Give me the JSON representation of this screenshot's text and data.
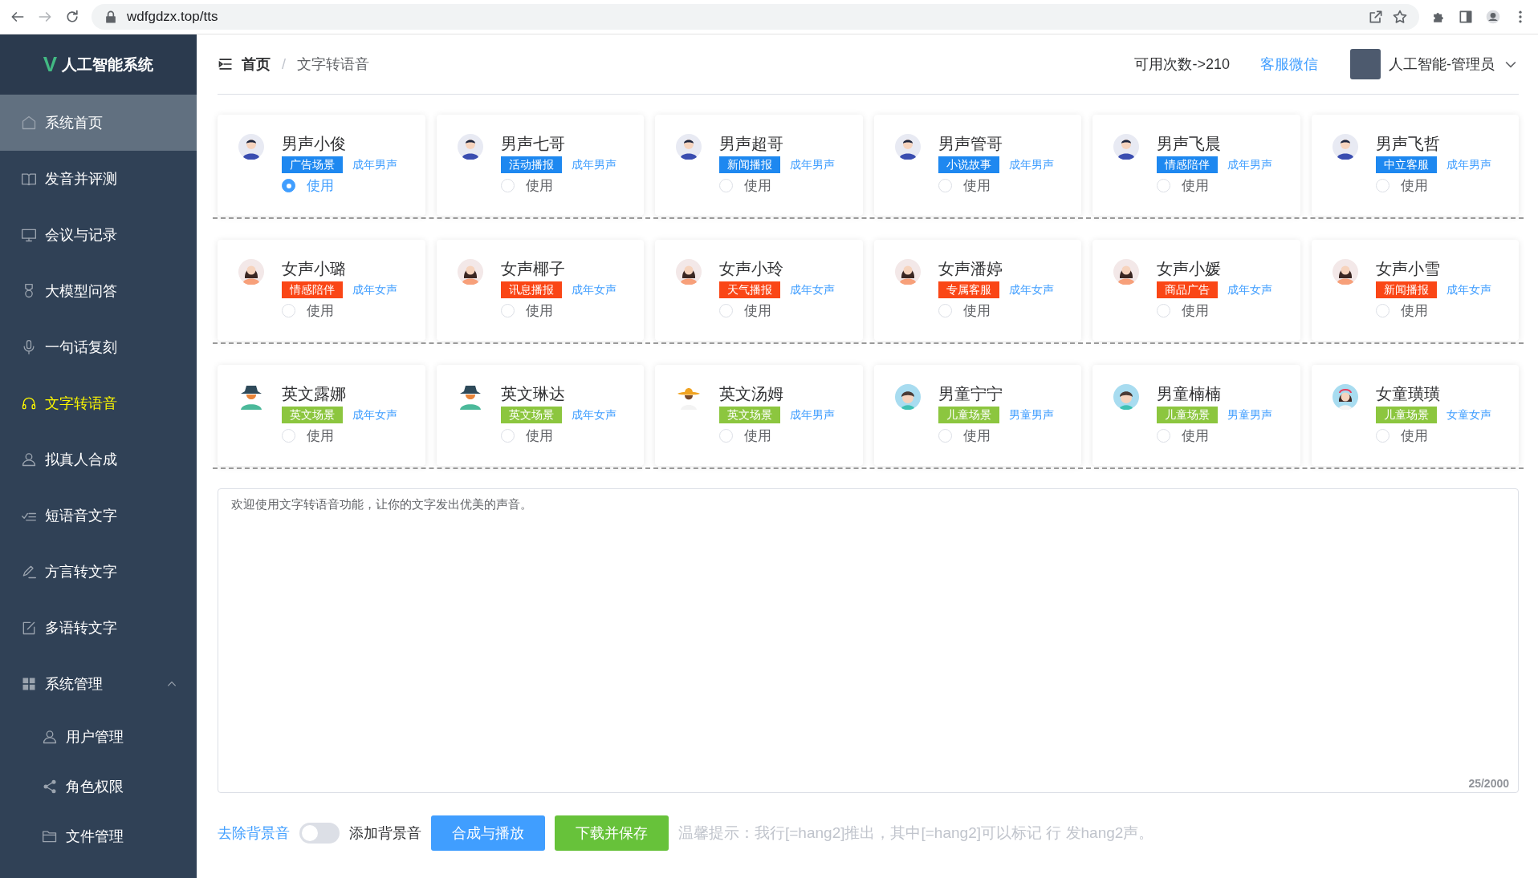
{
  "browser": {
    "url": "wdfgdzx.top/tts"
  },
  "sidebar": {
    "logo": "V",
    "title": "人工智能系统",
    "items": [
      {
        "label": "系统首页",
        "kind": "home",
        "selected": false,
        "hovered": true
      },
      {
        "label": "发音并评测",
        "kind": "book",
        "selected": false,
        "hovered": false
      },
      {
        "label": "会议与记录",
        "kind": "monitor",
        "selected": false,
        "hovered": false
      },
      {
        "label": "大模型问答",
        "kind": "medal",
        "selected": false,
        "hovered": false
      },
      {
        "label": "一句话复刻",
        "kind": "mic",
        "selected": false,
        "hovered": false
      },
      {
        "label": "文字转语音",
        "kind": "headset",
        "selected": true,
        "hovered": false
      },
      {
        "label": "拟真人合成",
        "kind": "user",
        "selected": false,
        "hovered": false
      },
      {
        "label": "短语音文字",
        "kind": "list",
        "selected": false,
        "hovered": false
      },
      {
        "label": "方言转文字",
        "kind": "pen",
        "selected": false,
        "hovered": false
      },
      {
        "label": "多语转文字",
        "kind": "edit",
        "selected": false,
        "hovered": false
      },
      {
        "label": "系统管理",
        "kind": "grid",
        "selected": false,
        "hovered": false,
        "expanded": true,
        "children": [
          {
            "label": "用户管理",
            "kind": "user",
            "selected": false,
            "hovered": false
          },
          {
            "label": "角色权限",
            "kind": "share",
            "selected": false,
            "hovered": false
          },
          {
            "label": "文件管理",
            "kind": "folder",
            "selected": false,
            "hovered": false
          }
        ]
      }
    ]
  },
  "header": {
    "breadcrumb": [
      "首页",
      "文字转语音"
    ],
    "separator": "/",
    "quota": "可用次数->210",
    "service_link": "客服微信",
    "user": "人工智能-管理员"
  },
  "voices": [
    {
      "name": "男声小俊",
      "kind": "man",
      "tag": "广告场景",
      "color": "#1e88f0",
      "category": "成年男声",
      "option": "使用",
      "selected": true
    },
    {
      "name": "男声七哥",
      "kind": "man",
      "tag": "活动播报",
      "color": "#1e88f0",
      "category": "成年男声",
      "option": "使用",
      "selected": false
    },
    {
      "name": "男声超哥",
      "kind": "man",
      "tag": "新闻播报",
      "color": "#1e88f0",
      "category": "成年男声",
      "option": "使用",
      "selected": false
    },
    {
      "name": "男声管哥",
      "kind": "man",
      "tag": "小说故事",
      "color": "#1e88f0",
      "category": "成年男声",
      "option": "使用",
      "selected": false
    },
    {
      "name": "男声飞晨",
      "kind": "man",
      "tag": "情感陪伴",
      "color": "#1e88f0",
      "category": "成年男声",
      "option": "使用",
      "selected": false
    },
    {
      "name": "男声飞哲",
      "kind": "man",
      "tag": "中立客服",
      "color": "#1e88f0",
      "category": "成年男声",
      "option": "使用",
      "selected": false
    },
    {
      "name": "女声小璐",
      "kind": "woman",
      "tag": "情感陪伴",
      "color": "#fa4616",
      "category": "成年女声",
      "option": "使用",
      "selected": false
    },
    {
      "name": "女声椰子",
      "kind": "woman",
      "tag": "讯息播报",
      "color": "#fa4616",
      "category": "成年女声",
      "option": "使用",
      "selected": false
    },
    {
      "name": "女声小玲",
      "kind": "woman",
      "tag": "天气播报",
      "color": "#fa4616",
      "category": "成年女声",
      "option": "使用",
      "selected": false
    },
    {
      "name": "女声潘婷",
      "kind": "woman",
      "tag": "专属客服",
      "color": "#fa4616",
      "category": "成年女声",
      "option": "使用",
      "selected": false
    },
    {
      "name": "女声小媛",
      "kind": "woman",
      "tag": "商品广告",
      "color": "#fa4616",
      "category": "成年女声",
      "option": "使用",
      "selected": false
    },
    {
      "name": "女声小雪",
      "kind": "woman",
      "tag": "新闻播报",
      "color": "#fa4616",
      "category": "成年女声",
      "option": "使用",
      "selected": false
    },
    {
      "name": "英文露娜",
      "kind": "hat",
      "tag": "英文场景",
      "color": "#8cc63f",
      "category": "成年女声",
      "option": "使用",
      "selected": false
    },
    {
      "name": "英文琳达",
      "kind": "hat",
      "tag": "英文场景",
      "color": "#8cc63f",
      "category": "成年女声",
      "option": "使用",
      "selected": false
    },
    {
      "name": "英文汤姆",
      "kind": "sombrero",
      "tag": "英文场景",
      "color": "#8cc63f",
      "category": "成年男声",
      "option": "使用",
      "selected": false
    },
    {
      "name": "男童宁宁",
      "kind": "boy",
      "tag": "儿童场景",
      "color": "#8cc63f",
      "category": "男童男声",
      "option": "使用",
      "selected": false
    },
    {
      "name": "男童楠楠",
      "kind": "boy",
      "tag": "儿童场景",
      "color": "#8cc63f",
      "category": "男童男声",
      "option": "使用",
      "selected": false
    },
    {
      "name": "女童璜璜",
      "kind": "girl",
      "tag": "儿童场景",
      "color": "#8cc63f",
      "category": "女童女声",
      "option": "使用",
      "selected": false
    }
  ],
  "editor": {
    "value": "欢迎使用文字转语音功能，让你的文字发出优美的声音。",
    "counter": "25/2000"
  },
  "controls": {
    "off_label": "去除背景音",
    "background_music": false,
    "on_label": "添加背景音",
    "buttons": [
      {
        "label": "合成与播放",
        "kind": "primary"
      },
      {
        "label": "下载并保存",
        "kind": "success"
      }
    ],
    "hint": "温馨提示：我行[=hang2]推出，其中[=hang2]可以标记 行 发hang2声。"
  }
}
